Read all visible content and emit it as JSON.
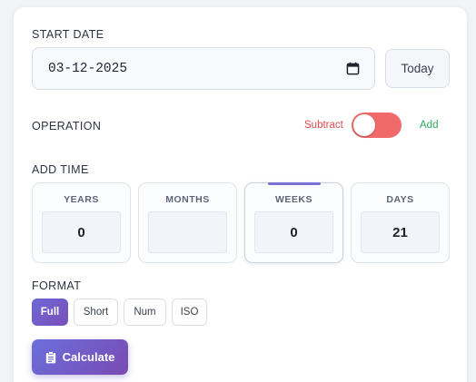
{
  "start_date": {
    "label": "START DATE",
    "value": "03-12-2025",
    "today_label": "Today",
    "icon": "calendar-icon"
  },
  "operation": {
    "label": "OPERATION",
    "subtract_label": "Subtract",
    "add_label": "Add",
    "mode": "subtract"
  },
  "add_time": {
    "label": "ADD TIME",
    "units": [
      {
        "label": "YEARS",
        "value": "0"
      },
      {
        "label": "MONTHS",
        "value": ""
      },
      {
        "label": "WEEKS",
        "value": "0"
      },
      {
        "label": "DAYS",
        "value": "21"
      }
    ],
    "focused_unit": "WEEKS"
  },
  "format": {
    "label": "FORMAT",
    "options": [
      "Full",
      "Short",
      "Num",
      "ISO"
    ],
    "selected": "Full"
  },
  "calculate": {
    "label": "Calculate",
    "icon": "clipboard-icon"
  },
  "colors": {
    "accent_start": "#6d67d8",
    "accent_end": "#7b4fb8",
    "subtract": "#e04a4a",
    "add": "#2ea85a",
    "toggle": "#f06a6a"
  }
}
